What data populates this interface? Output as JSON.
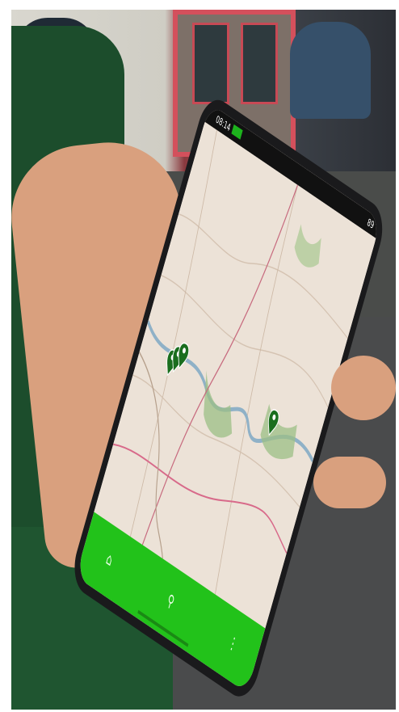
{
  "status": {
    "time": "08:14",
    "battery": "89"
  },
  "navbar": {
    "items": [
      {
        "icon": "home-icon"
      },
      {
        "icon": "map-pin-icon"
      },
      {
        "icon": "more-vertical-icon"
      }
    ],
    "active_index": 1,
    "color": "#22c21a"
  },
  "map": {
    "markers": [
      {
        "icon": "map-marker-icon"
      },
      {
        "icon": "map-marker-icon"
      },
      {
        "icon": "map-marker-icon"
      },
      {
        "icon": "map-marker-icon"
      }
    ]
  }
}
